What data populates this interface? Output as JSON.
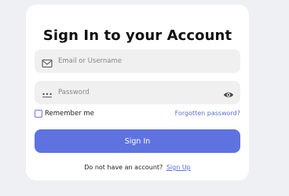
{
  "login": {
    "title": "Sign In to your Account",
    "email": {
      "placeholder": "Email or Username",
      "value": "",
      "icon": "mail-icon"
    },
    "password": {
      "placeholder": "Password",
      "value": "",
      "icon": "password-dots-icon",
      "toggle_icon": "eye-icon"
    },
    "remember_label": "Remember me",
    "remember_checked": false,
    "forgot_label": "Forgotten password?",
    "submit_label": "Sign In",
    "signup_prompt": "Do not have an account?",
    "signup_label": "Sign Up"
  },
  "colors": {
    "accent": "#5e73e0",
    "link": "#5a6fd6",
    "field_bg": "#f0f0f0",
    "page_bg": "#eef0f3"
  }
}
